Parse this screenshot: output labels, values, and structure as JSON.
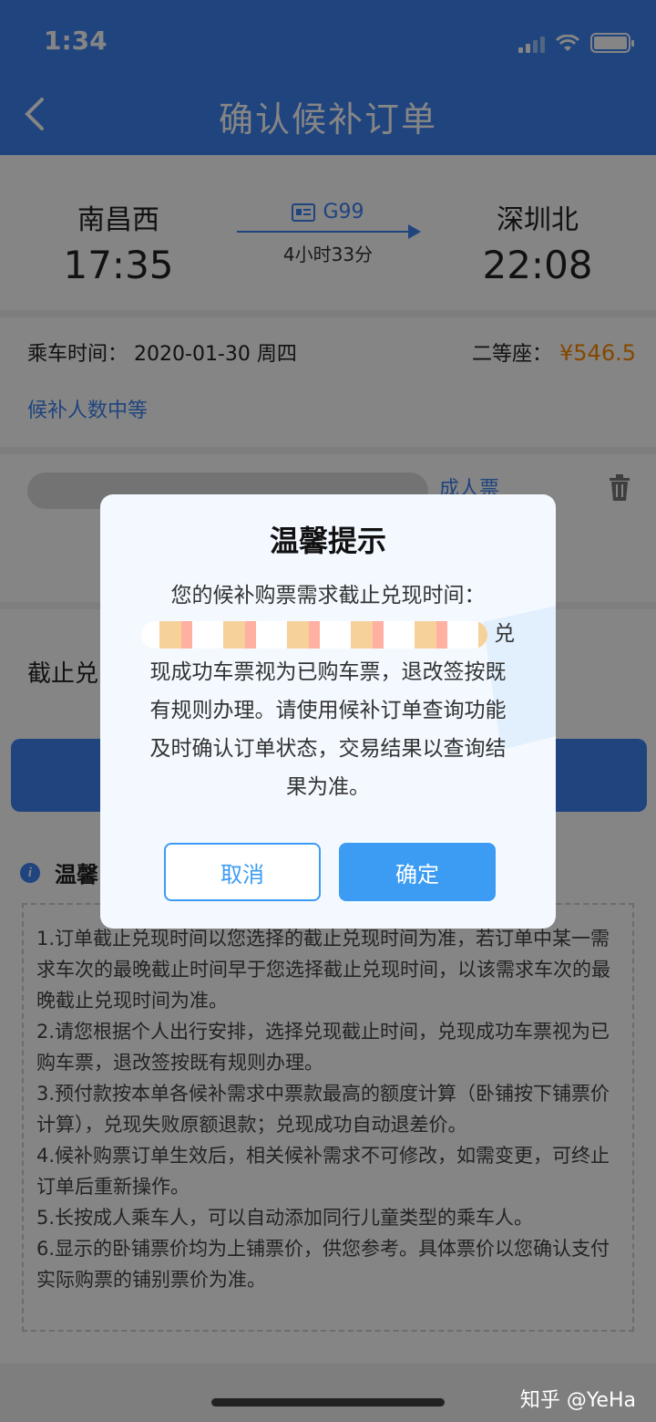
{
  "status_bar": {
    "time": "1:34"
  },
  "header": {
    "title": "确认候补订单"
  },
  "trip": {
    "from_station": "南昌西",
    "depart_time": "17:35",
    "train_no": "G99",
    "duration": "4小时33分",
    "to_station": "深圳北",
    "arrive_time": "22:08"
  },
  "ride": {
    "date_label": "乘车时间：",
    "date": "2020-01-30 周四",
    "seat_label": "二等座：",
    "price": "¥546.5",
    "waitlist_level": "候补人数中等"
  },
  "passenger": {
    "type": "成人票"
  },
  "deadline": {
    "label": "截止兑"
  },
  "tips": {
    "title": "温馨",
    "items": [
      "1.订单截止兑现时间以您选择的截止兑现时间为准，若订单中某一需求车次的最晚截止时间早于您选择截止兑现时间，以该需求车次的最晚截止兑现时间为准。",
      "2.请您根据个人出行安排，选择兑现截止时间，兑现成功车票视为已购车票，退改签按既有规则办理。",
      "3.预付款按本单各候补需求中票款最高的额度计算（卧铺按下铺票价计算），兑现失败原额退款；兑现成功自动退差价。",
      "4.候补购票订单生效后，相关候补需求不可修改，如需变更，可终止订单后重新操作。",
      "5.长按成人乘车人，可以自动添加同行儿童类型的乘车人。",
      "6.显示的卧铺票价均为上铺票价，供您参考。具体票价以您确认支付实际购票的铺别票价为准。"
    ]
  },
  "dialog": {
    "title": "温馨提示",
    "line1": "您的候补购票需求截止兑现时间：",
    "after_redact": "兑",
    "rest": "现成功车票视为已购车票，退改签按既有规则办理。请使用候补订单查询功能及时确认订单状态，交易结果以查询结果为准。",
    "cancel_label": "取消",
    "ok_label": "确定"
  },
  "watermark": "知乎 @YeHa",
  "colors": {
    "primary": "#3c82f1",
    "price": "#ff8a00",
    "dialog_button": "#3c9cf4"
  }
}
